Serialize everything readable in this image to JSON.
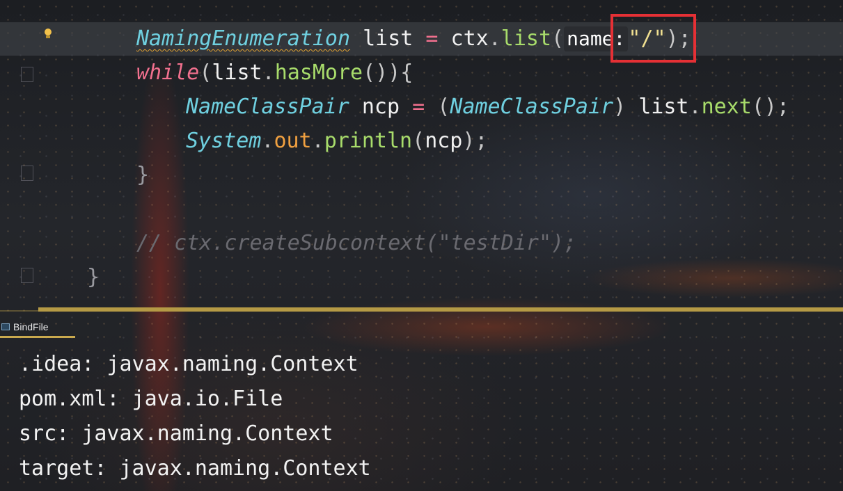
{
  "colors": {
    "accent_splitter": "#b59a45",
    "highlight_box": "#e53035",
    "type": "#6fd0e0",
    "keyword": "#f2708e",
    "method": "#a8dc6b",
    "field": "#f0a040",
    "string": "#f0e090",
    "comment": "#6a6a70"
  },
  "editor": {
    "gutter": {
      "bulb_icon": "lightbulb-icon"
    },
    "line1": {
      "type": "NamingEnumeration",
      "var": " list ",
      "op": "=",
      "obj": " ctx",
      "dot": ".",
      "method": "list",
      "open": "(",
      "hint": "name:",
      "str": "\"/\"",
      "close": ");"
    },
    "line2": {
      "kw": "while",
      "open": "(",
      "obj": "list",
      "dot": ".",
      "method": "hasMore",
      "rest": "()){"
    },
    "line3": {
      "type": "NameClassPair",
      "var": " ncp ",
      "op": "=",
      "cast_open": " (",
      "cast_type": "NameClassPair",
      "cast_close": ") ",
      "obj": "list",
      "dot": ".",
      "method": "next",
      "rest": "();"
    },
    "line4": {
      "type": "System",
      "dot1": ".",
      "field": "out",
      "dot2": ".",
      "method": "println",
      "open": "(",
      "arg": "ncp",
      "close": ");"
    },
    "line5": {
      "brace": "}"
    },
    "line6": {
      "comment": "// ctx.createSubcontext(\"testDir\");"
    },
    "line7": {
      "brace": "}"
    }
  },
  "tool_window": {
    "tab_label": "BindFile",
    "tab_icon": "console-icon"
  },
  "console": {
    "lines": [
      ".idea: javax.naming.Context",
      "pom.xml: java.io.File",
      "src: javax.naming.Context",
      "target: javax.naming.Context"
    ]
  }
}
